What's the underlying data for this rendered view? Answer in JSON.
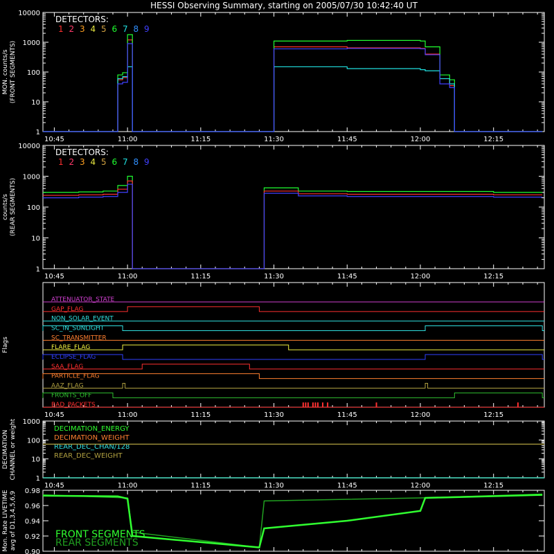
{
  "title": "HESSI Observing Summary, starting on 2005/07/30 10:42:40 UT",
  "colors": {
    "background": "#000000",
    "axes": "#ffffff",
    "det": [
      "#ff3030",
      "#ff3a6a",
      "#ffa020",
      "#e8e840",
      "#d0a040",
      "#20ff30",
      "#20e0e0",
      "#3090ff",
      "#4040ff"
    ]
  },
  "time_ticks": [
    "10:45",
    "11:00",
    "11:15",
    "11:30",
    "11:45",
    "12:00",
    "12:15"
  ],
  "chart_data": [
    {
      "id": "front",
      "type": "line",
      "title": "",
      "ylabel": [
        "MON. counts/s",
        "(FRONT SEGMENTS)"
      ],
      "yscale": "log",
      "ylim": [
        1,
        10000
      ],
      "y_ticks": [
        "1",
        "10",
        "100",
        "1000",
        "10000"
      ],
      "legend_title": "DETECTORS:",
      "legend_items": [
        "1",
        "2",
        "3",
        "4",
        "5",
        "6",
        "7",
        "8",
        "9"
      ],
      "x": [
        "10:42:40",
        "10:57",
        "10:58",
        "10:59",
        "11:00",
        "11:01",
        "11:02",
        "11:27",
        "11:30",
        "11:45",
        "12:00",
        "12:01",
        "12:04",
        "12:06",
        "12:07",
        "12:25"
      ],
      "series_ranges": [
        {
          "name": "1",
          "values": [
            1,
            1,
            55,
            65,
            1200,
            1,
            1,
            1,
            700,
            650,
            620,
            400,
            60,
            35,
            1,
            1
          ]
        },
        {
          "name": "6",
          "values": [
            1,
            1,
            80,
            95,
            1800,
            1,
            1,
            1,
            1100,
            1150,
            1100,
            700,
            80,
            55,
            1,
            1
          ]
        },
        {
          "name": "7",
          "values": [
            1,
            1,
            60,
            70,
            150,
            1,
            1,
            1,
            150,
            130,
            120,
            110,
            60,
            40,
            1,
            1
          ]
        },
        {
          "name": "9",
          "values": [
            1,
            1,
            40,
            45,
            900,
            1,
            1,
            1,
            600,
            620,
            600,
            380,
            40,
            30,
            1,
            1
          ]
        }
      ]
    },
    {
      "id": "rear",
      "type": "line",
      "ylabel": [
        "counts/s",
        "(REAR SEGMENTS)"
      ],
      "yscale": "log",
      "ylim": [
        1,
        10000
      ],
      "y_ticks": [
        "1",
        "10",
        "100",
        "1000",
        "10000"
      ],
      "legend_title": "DETECTORS:",
      "legend_items": [
        "1",
        "2",
        "3",
        "4",
        "5",
        "6",
        "7",
        "8",
        "9"
      ],
      "x": [
        "10:42:40",
        "10:50",
        "10:55",
        "10:58",
        "11:00",
        "11:01",
        "11:27",
        "11:28",
        "11:35",
        "11:45",
        "12:00",
        "12:15",
        "12:25"
      ],
      "series_ranges": [
        {
          "name": "6",
          "values": [
            300,
            310,
            330,
            500,
            1000,
            1,
            1,
            420,
            330,
            320,
            320,
            300,
            300
          ]
        },
        {
          "name": "1",
          "values": [
            240,
            250,
            260,
            380,
            700,
            1,
            1,
            330,
            270,
            260,
            260,
            250,
            250
          ]
        },
        {
          "name": "9",
          "values": [
            200,
            210,
            220,
            300,
            550,
            1,
            1,
            280,
            230,
            220,
            220,
            210,
            210
          ]
        }
      ]
    },
    {
      "id": "flags",
      "type": "line",
      "ylabel": [
        "Flags"
      ],
      "flags": [
        {
          "name": "ATTENUATOR_STATE",
          "color": "#d040d0",
          "on_intervals": []
        },
        {
          "name": "GAP_FLAG",
          "color": "#ff3030",
          "on_intervals": [
            [
              "11:00",
              "11:27"
            ]
          ]
        },
        {
          "name": "NON_SOLAR_EVENT",
          "color": "#30e0e0",
          "on_intervals": []
        },
        {
          "name": "SC_IN_SUNLIGHT",
          "color": "#30e0e0",
          "on_intervals": [
            [
              "10:42:40",
              "10:59"
            ],
            [
              "12:01",
              "12:25"
            ]
          ]
        },
        {
          "name": "SC_TRANSMITTER",
          "color": "#ff8030",
          "on_intervals": []
        },
        {
          "name": "FLARE_FLAG",
          "color": "#f0f040",
          "on_intervals": [
            [
              "10:59",
              "11:33"
            ]
          ]
        },
        {
          "name": "ECLIPSE_FLAG",
          "color": "#3040ff",
          "on_intervals": [
            [
              "10:42:40",
              "10:59"
            ],
            [
              "12:01",
              "12:25"
            ]
          ]
        },
        {
          "name": "SAA_FLAG",
          "color": "#ff3030",
          "on_intervals": [
            [
              "11:03",
              "11:25"
            ]
          ]
        },
        {
          "name": "PARTICLE_FLAG",
          "color": "#ff8030",
          "on_intervals": [
            [
              "10:42:40",
              "11:27"
            ]
          ]
        },
        {
          "name": "AAZ_FLAG",
          "color": "#b0a040",
          "on_intervals": [
            [
              "10:59",
              "10:59:30"
            ],
            [
              "12:01",
              "12:01:30"
            ]
          ]
        },
        {
          "name": "FRONTS_OFF",
          "color": "#30c030",
          "on_intervals": [
            [
              "10:42:40",
              "10:57"
            ],
            [
              "12:07",
              "12:25"
            ]
          ]
        },
        {
          "name": "BAD_PACKETS",
          "color": "#ff3030",
          "on_intervals": []
        }
      ],
      "bad_packet_times": [
        "11:36",
        "11:36:30",
        "11:37",
        "11:38",
        "11:38:30",
        "11:39",
        "11:40",
        "11:41",
        "11:51",
        "12:20"
      ]
    },
    {
      "id": "decimation",
      "type": "line",
      "ylabel": [
        "DECIMATION",
        "CHANNEL or weight"
      ],
      "yscale": "log",
      "ylim": [
        1,
        1000
      ],
      "y_ticks": [
        "1",
        "10",
        "100",
        "1000"
      ],
      "series": [
        {
          "name": "DECIMATION_ENERGY",
          "color": "#30ff30",
          "values": [
            1,
            1
          ]
        },
        {
          "name": "DECIMATION_WEIGHT",
          "color": "#ff8030",
          "values": [
            1,
            1
          ]
        },
        {
          "name": "REAR_DEC_CHAN/128",
          "color": "#30e0e0",
          "values": [
            1,
            1
          ]
        },
        {
          "name": "REAR_DEC_WEIGHT",
          "color": "#b0a040",
          "values": [
            60,
            60
          ]
        }
      ]
    },
    {
      "id": "livetime",
      "type": "line",
      "ylabel": [
        "Mon. Rate LIVETIME",
        "avg of D1,3,4,5,6,9"
      ],
      "ylim": [
        0.9,
        0.98
      ],
      "y_ticks": [
        "0.90",
        "0.92",
        "0.94",
        "0.96",
        "0.98"
      ],
      "series": [
        {
          "name": "FRONT SEGMENTS",
          "color": "#30ff30",
          "x": [
            "10:42:40",
            "10:58",
            "11:00",
            "11:01",
            "11:27",
            "11:28",
            "11:45",
            "12:00",
            "12:01",
            "12:25"
          ],
          "values": [
            0.973,
            0.972,
            0.969,
            0.92,
            0.905,
            0.93,
            0.94,
            0.953,
            0.97,
            0.974
          ]
        },
        {
          "name": "REAR SEGMENTS",
          "color": "#20a020",
          "x": [
            "10:42:40",
            "11:00",
            "11:01",
            "11:27",
            "11:28",
            "12:00",
            "12:25"
          ],
          "values": [
            0.974,
            0.97,
            0.925,
            0.905,
            0.966,
            0.97,
            0.975
          ]
        }
      ]
    }
  ]
}
